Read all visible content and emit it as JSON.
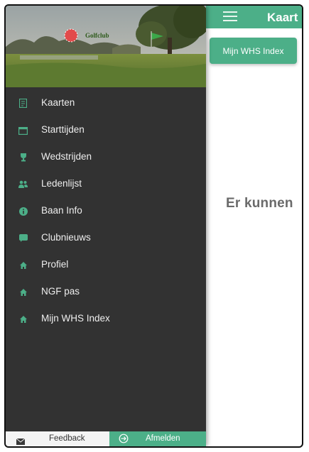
{
  "appbar": {
    "title": "Kaart",
    "menu_icon": "hamburger-icon",
    "color": "#4caf88"
  },
  "main": {
    "whs_button_label": "Mijn WHS Index",
    "empty_message": "Er kunnen"
  },
  "drawer": {
    "header_image": "golf-course-photo",
    "logo_text": "Golfclub",
    "items": [
      {
        "label": "Kaarten",
        "icon": "cards-icon"
      },
      {
        "label": "Starttijden",
        "icon": "calendar-icon"
      },
      {
        "label": "Wedstrijden",
        "icon": "trophy-icon"
      },
      {
        "label": "Ledenlijst",
        "icon": "members-icon"
      },
      {
        "label": "Baan Info",
        "icon": "info-icon"
      },
      {
        "label": "Clubnieuws",
        "icon": "chat-icon"
      },
      {
        "label": "Profiel",
        "icon": "home-icon"
      },
      {
        "label": "NGF pas",
        "icon": "home-icon"
      },
      {
        "label": "Mijn WHS Index",
        "icon": "home-icon"
      }
    ],
    "icon_color": "#4caf88",
    "background": "#323232"
  },
  "footer": {
    "feedback_label": "Feedback",
    "feedback_icon": "envelope-icon",
    "logout_label": "Afmelden",
    "logout_icon": "logout-icon"
  }
}
